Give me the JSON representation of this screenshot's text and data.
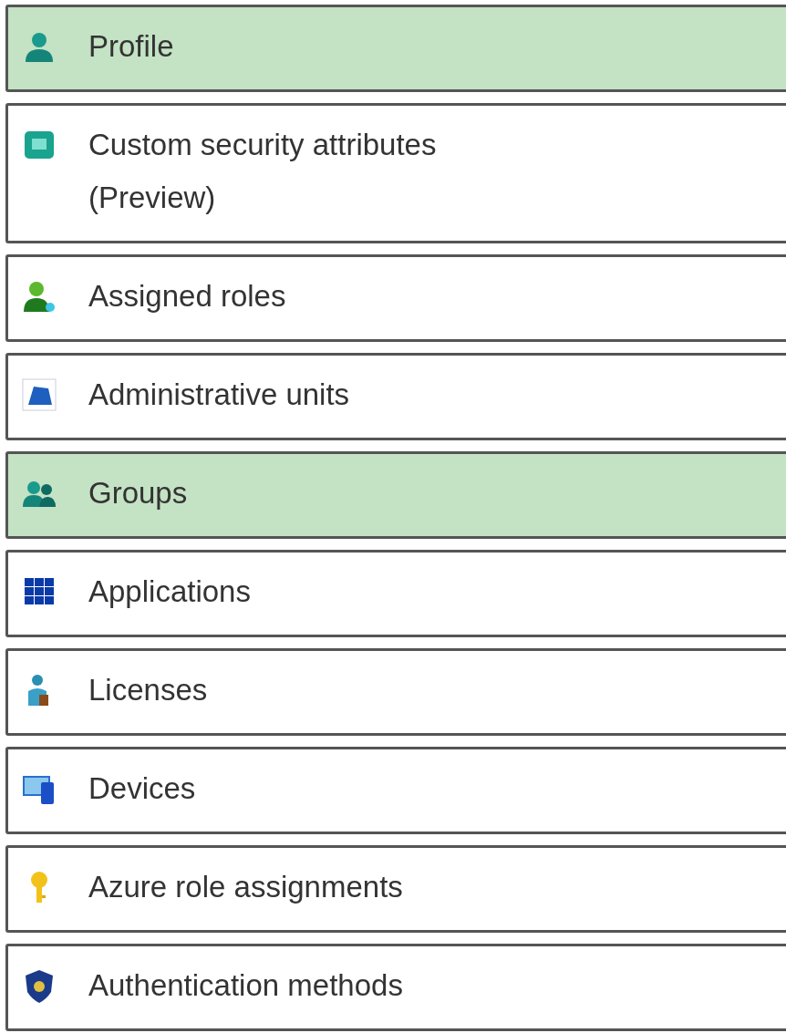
{
  "menu": {
    "items": [
      {
        "label": "Profile",
        "selected": true
      },
      {
        "label": "Custom security attributes (Preview)",
        "selected": false
      },
      {
        "label": "Assigned roles",
        "selected": false
      },
      {
        "label": "Administrative units",
        "selected": false
      },
      {
        "label": "Groups",
        "selected": true
      },
      {
        "label": "Applications",
        "selected": false
      },
      {
        "label": "Licenses",
        "selected": false
      },
      {
        "label": "Devices",
        "selected": false
      },
      {
        "label": "Azure role assignments",
        "selected": false
      },
      {
        "label": "Authentication methods",
        "selected": false
      }
    ]
  }
}
